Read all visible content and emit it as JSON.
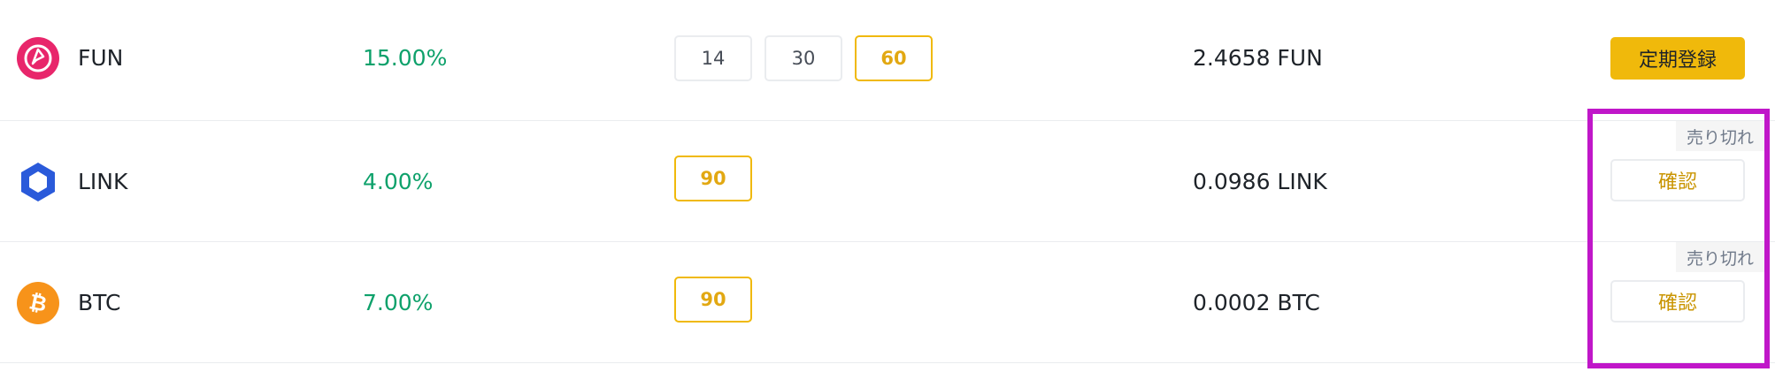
{
  "rows": [
    {
      "coin": "FUN",
      "rate": "15.00%",
      "durations": [
        "14",
        "30",
        "60"
      ],
      "active_duration_index": 2,
      "amount": "2.4658 FUN",
      "action_label": "定期登録",
      "sold_out_label": "",
      "icon": "fun-coin-icon",
      "icon_color": "#e8266b"
    },
    {
      "coin": "LINK",
      "rate": "4.00%",
      "durations": [
        "90"
      ],
      "active_duration_index": 0,
      "amount": "0.0986 LINK",
      "action_label": "確認",
      "sold_out_label": "売り切れ",
      "icon": "link-coin-icon",
      "icon_color": "#2a5ada"
    },
    {
      "coin": "BTC",
      "rate": "7.00%",
      "durations": [
        "90"
      ],
      "active_duration_index": 0,
      "amount": "0.0002 BTC",
      "action_label": "確認",
      "sold_out_label": "売り切れ",
      "icon": "btc-coin-icon",
      "icon_color": "#f7931a"
    }
  ],
  "colors": {
    "accent": "#f0b90b",
    "positive": "#0ea16b",
    "highlight": "#c017c9"
  }
}
